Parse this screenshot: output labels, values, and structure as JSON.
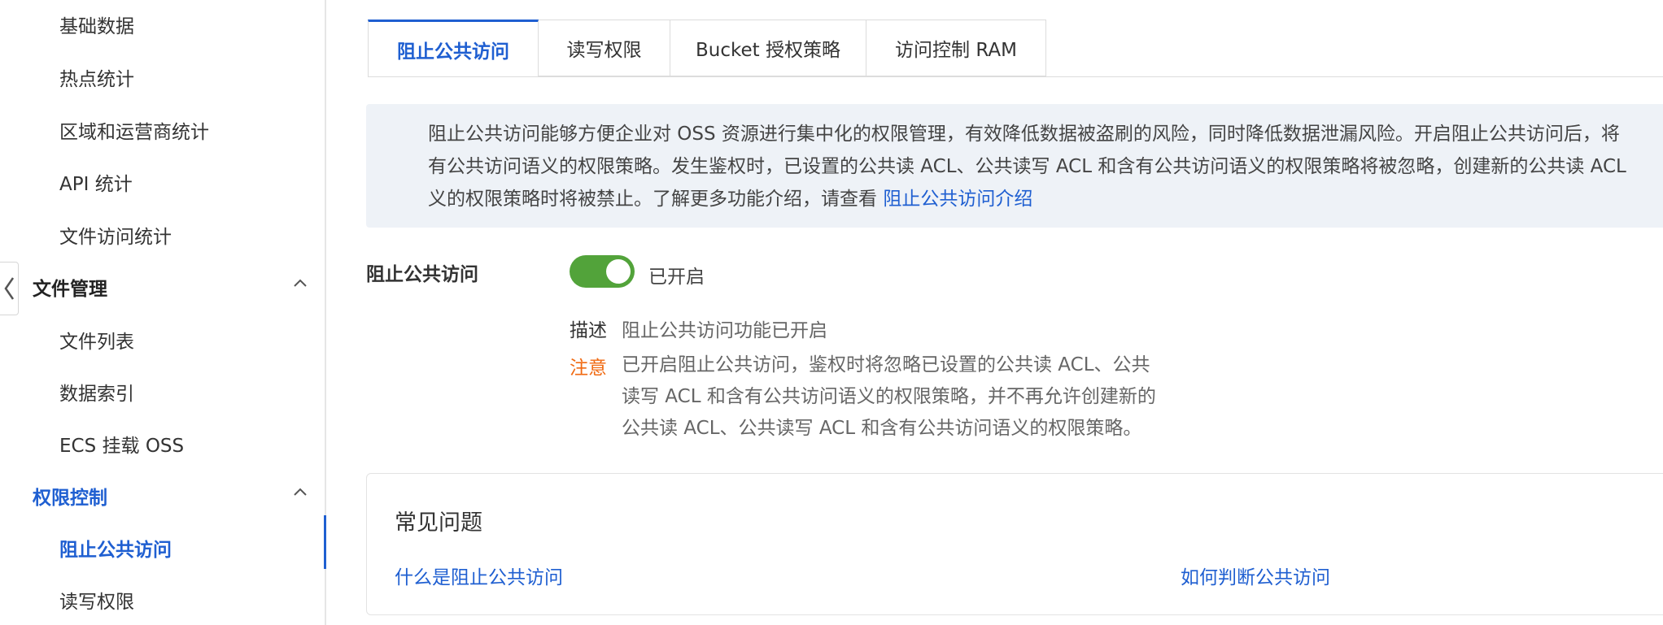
{
  "sidebar": {
    "items_top": [
      {
        "label": "基础数据"
      },
      {
        "label": "热点统计"
      },
      {
        "label": "区域和运营商统计"
      },
      {
        "label": "API 统计"
      },
      {
        "label": "文件访问统计"
      }
    ],
    "group_file": {
      "label": "文件管理"
    },
    "items_file": [
      {
        "label": "文件列表"
      },
      {
        "label": "数据索引"
      },
      {
        "label": "ECS 挂载 OSS"
      }
    ],
    "group_perm": {
      "label": "权限控制"
    },
    "items_perm": [
      {
        "label": "阻止公共访问"
      },
      {
        "label": "读写权限"
      }
    ]
  },
  "tabs": [
    {
      "label": "阻止公共访问",
      "active": true
    },
    {
      "label": "读写权限"
    },
    {
      "label": "Bucket 授权策略"
    },
    {
      "label": "访问控制 RAM"
    }
  ],
  "banner": {
    "line1": "阻止公共访问能够方便企业对 OSS 资源进行集中化的权限管理，有效降低数据被盗刷的风险，同时降低数据泄漏风险。开启阻止公共访问后，将",
    "line2": "有公共访问语义的权限策略。发生鉴权时，已设置的公共读 ACL、公共读写 ACL 和含有公共访问语义的权限策略将被忽略，创建新的公共读 ACL",
    "line3_prefix": "义的权限策略时将被禁止。了解更多功能介绍，请查看 ",
    "line3_link": "阻止公共访问介绍"
  },
  "setting": {
    "label": "阻止公共访问",
    "state": "已开启",
    "enabled": true,
    "desc_key": "描述",
    "desc_value": "阻止公共访问功能已开启",
    "note_key": "注意",
    "note_lines": [
      "已开启阻止公共访问，鉴权时将忽略已设置的公共读 ACL、公共",
      "读写 ACL 和含有公共访问语义的权限策略，并不再允许创建新的",
      "公共读 ACL、公共读写 ACL 和含有公共访问语义的权限策略。"
    ]
  },
  "faq": {
    "title": "常见问题",
    "links": [
      "什么是阻止公共访问",
      "如何判断公共访问"
    ]
  },
  "colors": {
    "accent": "#1f5fd1",
    "toggle_on": "#52a33a",
    "warning": "#f06a12",
    "banner_bg": "#eef2f7"
  },
  "icons": [
    "chevron-up-icon",
    "chevron-left-icon"
  ]
}
